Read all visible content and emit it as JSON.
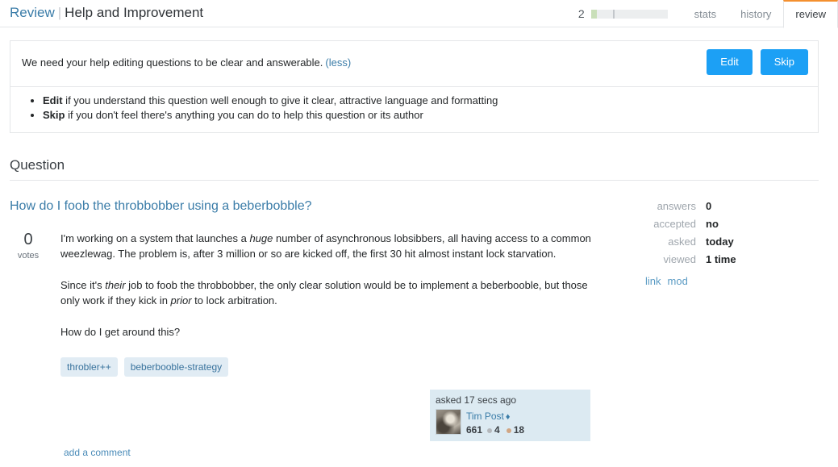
{
  "header": {
    "breadcrumb_link": "Review",
    "breadcrumb_separator": "|",
    "breadcrumb_current": "Help and Improvement",
    "progress_count": "2",
    "tabs": [
      {
        "label": "stats",
        "active": false
      },
      {
        "label": "history",
        "active": false
      },
      {
        "label": "review",
        "active": true
      }
    ]
  },
  "notice": {
    "text": "We need your help editing questions to be clear and answerable.",
    "less_label": "(less)",
    "edit_button": "Edit",
    "skip_button": "Skip",
    "bullets": [
      {
        "bold": "Edit",
        "rest": " if you understand this question well enough to give it clear, attractive language and formatting"
      },
      {
        "bold": "Skip",
        "rest": " if you don't feel there's anything you can do to help this question or its author"
      }
    ]
  },
  "question_section": {
    "heading": "Question",
    "title": "How do I foob the throbbobber using a beberbobble?",
    "votes_count": "0",
    "votes_label": "votes",
    "paragraphs": [
      {
        "part1": "I'm working on a system that launches a ",
        "em1": "huge",
        "part2": " number of asynchronous lobsibbers, all having access to a common weezlewag. The problem is, after 3 million or so are kicked off, the first 30 hit almost instant lock starvation.",
        "em2": "",
        "part3": ""
      },
      {
        "part1": "Since it's ",
        "em1": "their",
        "part2": " job to foob the throbbobber, the only clear solution would be to implement a beberbooble, but those only work if they kick in ",
        "em2": "prior",
        "part3": " to lock arbitration."
      },
      {
        "part1": "How do I get around this?",
        "em1": "",
        "part2": "",
        "em2": "",
        "part3": ""
      }
    ],
    "tags": [
      "throbler++",
      "beberbooble-strategy"
    ],
    "add_comment": "add a comment"
  },
  "stats": {
    "rows": [
      {
        "key": "answers",
        "value": "0"
      },
      {
        "key": "accepted",
        "value": "no"
      },
      {
        "key": "asked",
        "value": "today"
      },
      {
        "key": "viewed",
        "value": "1 time"
      }
    ],
    "links": [
      "link",
      "mod"
    ]
  },
  "user_card": {
    "action": "asked 17 secs ago",
    "name": "Tim Post",
    "mod_diamond": "♦",
    "reputation": "661",
    "silver_badges": "4",
    "bronze_badges": "18"
  },
  "colors": {
    "link": "#3a7ca8",
    "button": "#1ca0f5",
    "active_tab_border": "#f4902f",
    "tag_bg": "#e1ecf4",
    "user_card_bg": "#dceaf2"
  }
}
